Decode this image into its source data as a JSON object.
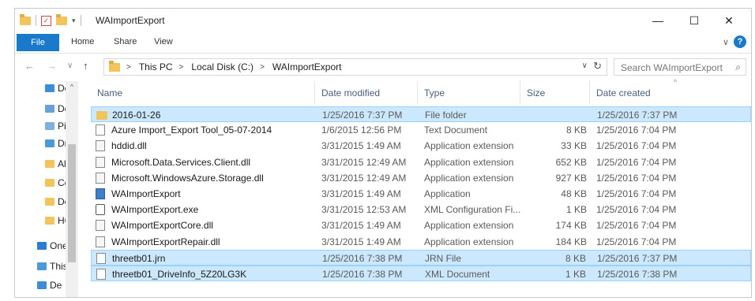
{
  "window": {
    "title": "WAImportExport",
    "controls": {
      "minimize": "—",
      "maximize": "☐",
      "close": "✕"
    }
  },
  "ribbon": {
    "file": "File",
    "tabs": [
      "Home",
      "Share",
      "View"
    ]
  },
  "address": {
    "breadcrumbs": [
      "This PC",
      "Local Disk (C:)",
      "WAImportExport"
    ],
    "search_placeholder": "Search WAImportExport"
  },
  "nav_pane": {
    "items": [
      {
        "label": "Dc",
        "icon": "download-icon",
        "color": "#3b8fd6"
      },
      {
        "label": "Dc",
        "icon": "documents-icon",
        "color": "#6aa0d8"
      },
      {
        "label": "Pic",
        "icon": "pictures-icon",
        "color": "#7fb0e0"
      },
      {
        "label": "Dr",
        "icon": "drive-icon",
        "color": "#4a9ad8"
      },
      {
        "label": "Ale",
        "icon": "folder-icon",
        "color": "#f2c55c"
      },
      {
        "label": "Cc",
        "icon": "folder-icon",
        "color": "#f2c55c"
      },
      {
        "label": "De",
        "icon": "folder-icon",
        "color": "#f2c55c"
      },
      {
        "label": "HC",
        "icon": "folder-icon",
        "color": "#f2c55c"
      },
      {
        "label": "One",
        "icon": "onedrive-icon",
        "color": "#2b7cd3"
      },
      {
        "label": "This",
        "icon": "this-pc-icon",
        "color": "#4a9ad8"
      },
      {
        "label": "De",
        "icon": "desktop-icon",
        "color": "#3b8fd6"
      }
    ]
  },
  "columns": {
    "name": "Name",
    "date_modified": "Date modified",
    "type": "Type",
    "size": "Size",
    "date_created": "Date created"
  },
  "files": [
    {
      "name": "2016-01-26",
      "modified": "1/25/2016 7:37 PM",
      "type": "File folder",
      "size": "",
      "created": "1/25/2016 7:37 PM",
      "icon": "folder-icon",
      "selected": true
    },
    {
      "name": "Azure Import_Export Tool_05-07-2014",
      "modified": "1/6/2015 12:56 PM",
      "type": "Text Document",
      "size": "8 KB",
      "created": "1/25/2016 7:04 PM",
      "icon": "text-document-icon",
      "selected": false
    },
    {
      "name": "hddid.dll",
      "modified": "3/31/2015 1:49 AM",
      "type": "Application extension",
      "size": "33 KB",
      "created": "1/25/2016 7:04 PM",
      "icon": "dll-file-icon",
      "selected": false
    },
    {
      "name": "Microsoft.Data.Services.Client.dll",
      "modified": "3/31/2015 12:49 AM",
      "type": "Application extension",
      "size": "652 KB",
      "created": "1/25/2016 7:04 PM",
      "icon": "dll-file-icon",
      "selected": false
    },
    {
      "name": "Microsoft.WindowsAzure.Storage.dll",
      "modified": "3/31/2015 12:49 AM",
      "type": "Application extension",
      "size": "927 KB",
      "created": "1/25/2016 7:04 PM",
      "icon": "dll-file-icon",
      "selected": false
    },
    {
      "name": "WAImportExport",
      "modified": "3/31/2015 1:49 AM",
      "type": "Application",
      "size": "48 KB",
      "created": "1/25/2016 7:04 PM",
      "icon": "application-icon",
      "selected": false
    },
    {
      "name": "WAImportExport.exe",
      "modified": "3/31/2015 12:53 AM",
      "type": "XML Configuration Fi...",
      "size": "1 KB",
      "created": "1/25/2016 7:04 PM",
      "icon": "config-file-icon",
      "selected": false
    },
    {
      "name": "WAImportExportCore.dll",
      "modified": "3/31/2015 1:49 AM",
      "type": "Application extension",
      "size": "174 KB",
      "created": "1/25/2016 7:04 PM",
      "icon": "dll-file-icon",
      "selected": false
    },
    {
      "name": "WAImportExportRepair.dll",
      "modified": "3/31/2015 1:49 AM",
      "type": "Application extension",
      "size": "184 KB",
      "created": "1/25/2016 7:04 PM",
      "icon": "dll-file-icon",
      "selected": false
    },
    {
      "name": "threetb01.jrn",
      "modified": "1/25/2016 7:38 PM",
      "type": "JRN File",
      "size": "8 KB",
      "created": "1/25/2016 7:37 PM",
      "icon": "file-icon",
      "selected": true
    },
    {
      "name": "threetb01_DriveInfo_5Z20LG3K",
      "modified": "1/25/2016 7:38 PM",
      "type": "XML Document",
      "size": "1 KB",
      "created": "1/25/2016 7:38 PM",
      "icon": "xml-document-icon",
      "selected": true
    }
  ],
  "colors": {
    "accent": "#1979ca",
    "selection": "#cce8ff",
    "selection_border": "#99d1ff",
    "folder": "#f2c55c"
  }
}
